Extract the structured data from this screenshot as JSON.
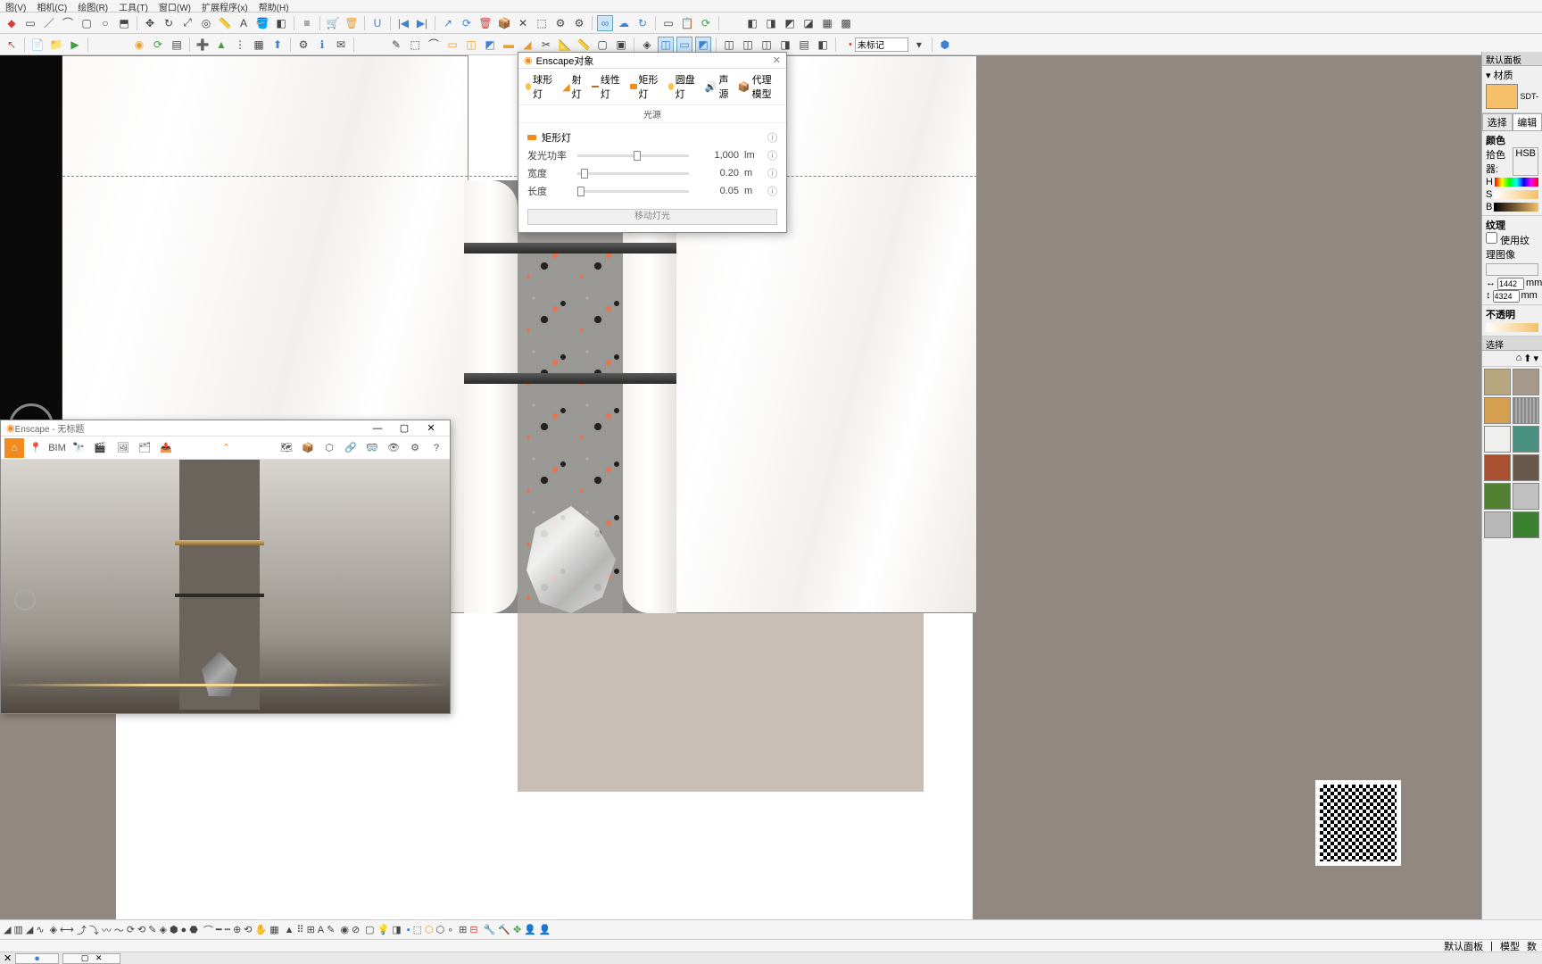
{
  "menu": {
    "items": [
      "图(V)",
      "相机(C)",
      "绘图(R)",
      "工具(T)",
      "窗口(W)",
      "扩展程序(x)",
      "帮助(H)"
    ]
  },
  "tag_selector": "未标记",
  "enscape": {
    "title": "Enscape - 无标题"
  },
  "dialog": {
    "title": "Enscape对象",
    "tabs": {
      "sphere": "球形灯",
      "spot": "射灯",
      "line": "线性灯",
      "rect": "矩形灯",
      "disc": "圆盘灯",
      "sound": "声源",
      "proxy": "代理模型"
    },
    "subtitle": "光源",
    "section": "矩形灯",
    "rows": {
      "power": {
        "label": "发光功率",
        "value": "1,000",
        "unit": "lm"
      },
      "width": {
        "label": "宽度",
        "value": "0.20",
        "unit": "m"
      },
      "length": {
        "label": "长度",
        "value": "0.05",
        "unit": "m"
      }
    },
    "button": "移动灯光"
  },
  "panel": {
    "title": "默认面板",
    "material": "材质",
    "mat_name": "SDT-",
    "tab_select": "选择",
    "tab_edit": "编辑",
    "color": "颜色",
    "picker": "拾色器:",
    "picker_mode": "HSB",
    "texture": "纹理",
    "use_tex": "使用纹理图像",
    "dim_w": "1442",
    "dim_h": "4324",
    "dim_unit": "mm",
    "opacity": "不透明",
    "select2": "选择"
  },
  "status": {
    "tray": "默认面板",
    "model": "模型",
    "count": "数"
  }
}
